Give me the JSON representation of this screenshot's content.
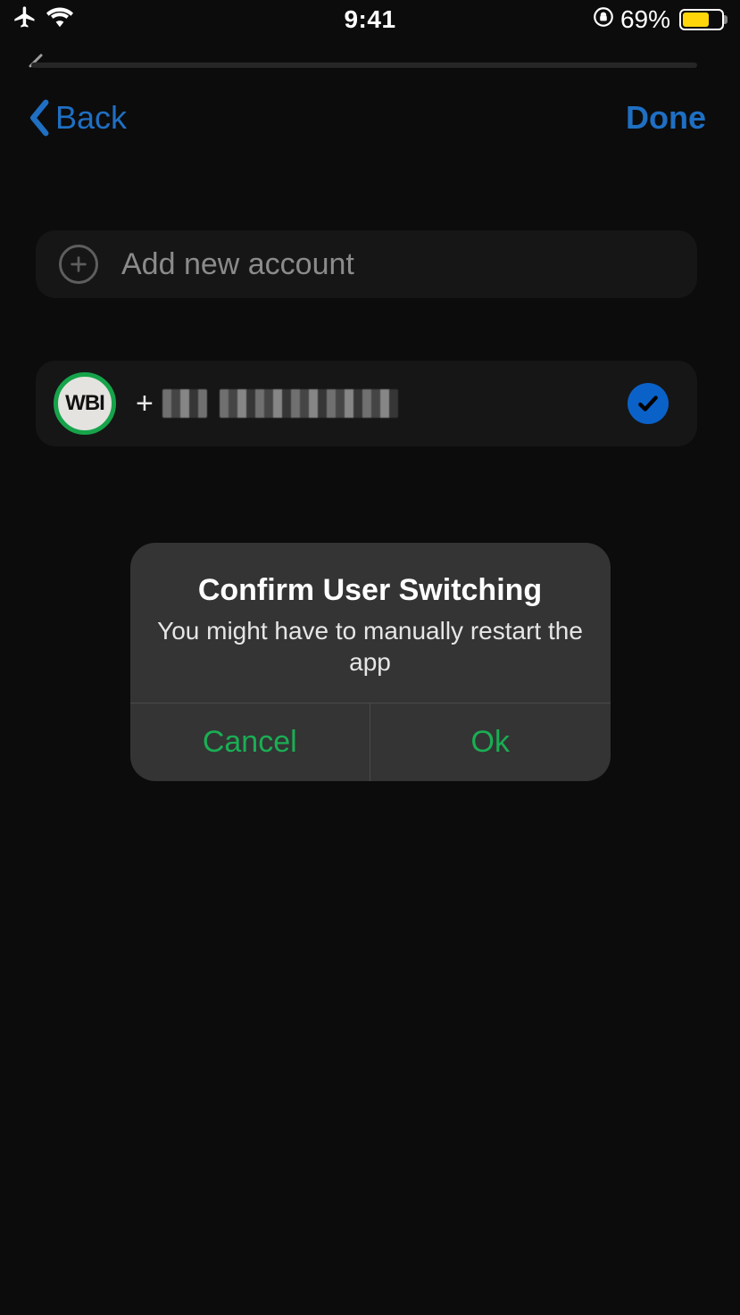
{
  "status_bar": {
    "time": "9:41",
    "battery_pct": "69%",
    "battery_level": 69
  },
  "nav": {
    "back_label": "Back",
    "done_label": "Done"
  },
  "cells": {
    "add_label": "Add new account",
    "account": {
      "avatar_text": "WBI",
      "phone_prefix": "+",
      "selected": true
    }
  },
  "dialog": {
    "title": "Confirm User Switching",
    "message": "You might have to manually restart the app",
    "cancel_label": "Cancel",
    "ok_label": "Ok"
  },
  "colors": {
    "accent_blue": "#1f6fc3",
    "accent_green": "#1aae54",
    "battery_yellow": "#ffd60a",
    "avatar_ring": "#16a34a",
    "check_bg": "#0a62c8"
  }
}
